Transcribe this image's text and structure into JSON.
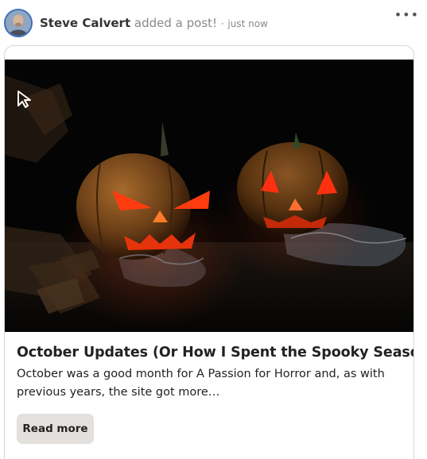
{
  "post_header": {
    "author": "Steve Calvert",
    "action": "added a post!",
    "separator": "·",
    "timestamp": "just now",
    "menu_icon": "more-horizontal-icon"
  },
  "post": {
    "image_alt_icon": "jack-o-lantern-photo",
    "title": "October Updates (Or How I Spent the Spooky Season)",
    "excerpt": "October was a good month for A Passion for Horror and, as with previous years, the site got more…",
    "read_more_label": "Read more"
  },
  "colors": {
    "avatar_ring": "#3b6ec2",
    "button_bg": "#e3e0dd",
    "card_border": "#d6d6d6"
  }
}
